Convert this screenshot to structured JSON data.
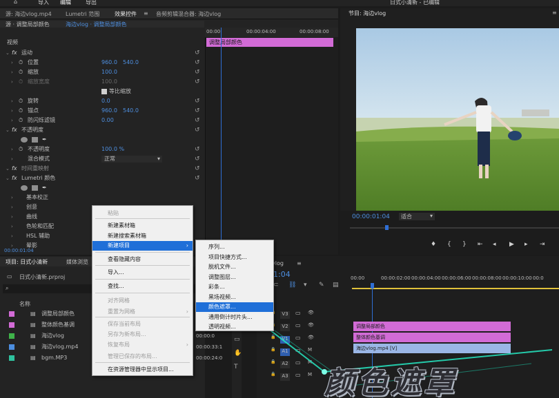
{
  "topbar": {
    "tabs": [
      "导入",
      "编辑",
      "导出"
    ],
    "title": "日式小清新 - 已编辑"
  },
  "effect_controls": {
    "tabs": [
      "源: 海边vlog.mp4",
      "Lumetri 范围",
      "效果控件",
      "音频剪辑混合器: 海边vlog"
    ],
    "source_label": "源 · 调整局部颜色",
    "sequence_label": "海边vlog · 调整局部颜色",
    "section_video": "视频",
    "ruler": [
      "00:00",
      "00:00:04:00",
      "00:00:08:00"
    ],
    "clip_label": "调整局部颜色",
    "rows": [
      {
        "label": "运动",
        "fx": true
      },
      {
        "label": "位置",
        "v1": "960.0",
        "v2": "540.0"
      },
      {
        "label": "缩放",
        "v1": "100.0"
      },
      {
        "label": "缩放宽度",
        "v1": "100.0",
        "disabled": true
      },
      {
        "label": "等比缩放",
        "checkbox": true
      },
      {
        "label": "旋转",
        "v1": "0.0"
      },
      {
        "label": "锚点",
        "v1": "960.0",
        "v2": "540.0"
      },
      {
        "label": "防闪烁滤镜",
        "v1": "0.00"
      },
      {
        "label": "不透明度",
        "fx": true
      },
      {
        "label": "",
        "shapes": true
      },
      {
        "label": "不透明度",
        "v1": "100.0 %"
      },
      {
        "label": "混合模式",
        "select": "正常"
      },
      {
        "label": "时间重映射",
        "fx": true,
        "dim": true
      },
      {
        "label": "Lumetri 颜色",
        "fx": true
      },
      {
        "label": "",
        "shapes": true
      },
      {
        "label": "基本校正"
      },
      {
        "label": "创意"
      },
      {
        "label": "曲线"
      },
      {
        "label": "色轮和匹配"
      },
      {
        "label": "HSL 辅助"
      },
      {
        "label": "晕影"
      }
    ],
    "timecode": "00:00:01:04"
  },
  "program_monitor": {
    "title": "节目: 海边vlog",
    "timecode": "00:00:01:04",
    "fit": "适合",
    "icons": [
      "marker-icon",
      "in-icon",
      "out-icon",
      "go-in-icon",
      "step-back-icon",
      "play-icon",
      "step-forward-icon",
      "go-out-icon"
    ]
  },
  "project": {
    "tabs": [
      "项目: 日式小清新",
      "媒体浏览"
    ],
    "file": "日式小清新.prproj",
    "column_name": "名称",
    "items": [
      {
        "name": "调整局部颜色",
        "color": "#d26bd6",
        "dur": ""
      },
      {
        "name": "整体颜色基调",
        "color": "#d26bd6",
        "dur": ""
      },
      {
        "name": "海边vlog",
        "color": "#3fb34a",
        "dur": "00:00:0"
      },
      {
        "name": "海边vlog.mp4",
        "color": "#4c8ee0",
        "dur": "00:00:33:1"
      },
      {
        "name": "bgm.MP3",
        "color": "#2fc29e",
        "dur": "00:00:24:0"
      }
    ]
  },
  "timeline": {
    "title": "vlog",
    "timecode": "1:04",
    "ruler": [
      "00:00",
      "00:00:02:00",
      "00:00:04:00",
      "00:00:06:00",
      "00:00:08:00",
      "00:00:10:00",
      "00:0"
    ],
    "tracks": [
      "V3",
      "V2",
      "V1",
      "A1",
      "A2",
      "A3"
    ],
    "clips": [
      {
        "label": "调整局部颜色",
        "color": "#d26bd6"
      },
      {
        "label": "整体颜色基调",
        "color": "#d26bd6"
      },
      {
        "label": "海边vlog.mp4 [V]",
        "color": "#9ab6e6"
      }
    ]
  },
  "context_menu": {
    "items": [
      {
        "label": "粘贴",
        "disabled": true
      },
      {
        "label": "新建素材箱"
      },
      {
        "label": "新建搜索素材箱"
      },
      {
        "label": "新建项目",
        "selected": true,
        "arrow": true
      },
      {
        "label": "查看隐藏内容"
      },
      {
        "label": "导入..."
      },
      {
        "label": "查找..."
      },
      {
        "label": "对齐网格",
        "disabled": true
      },
      {
        "label": "重置为网格",
        "disabled": true,
        "arrow": true
      },
      {
        "label": "保存当前布局",
        "disabled": true
      },
      {
        "label": "另存为新布局...",
        "disabled": true
      },
      {
        "label": "恢复布局",
        "disabled": true,
        "arrow": true
      },
      {
        "label": "管理已保存的布局...",
        "disabled": true
      },
      {
        "label": "在资源管理器中显示项目..."
      }
    ]
  },
  "submenu": {
    "items": [
      {
        "label": "序列..."
      },
      {
        "label": "项目快捷方式..."
      },
      {
        "label": "脱机文件..."
      },
      {
        "label": "调整图层..."
      },
      {
        "label": "彩条..."
      },
      {
        "label": "黑场视频..."
      },
      {
        "label": "颜色遮罩...",
        "selected": true
      },
      {
        "label": "通用倒计时片头..."
      },
      {
        "label": "透明视频..."
      }
    ]
  },
  "overlay_title": "颜色遮罩"
}
